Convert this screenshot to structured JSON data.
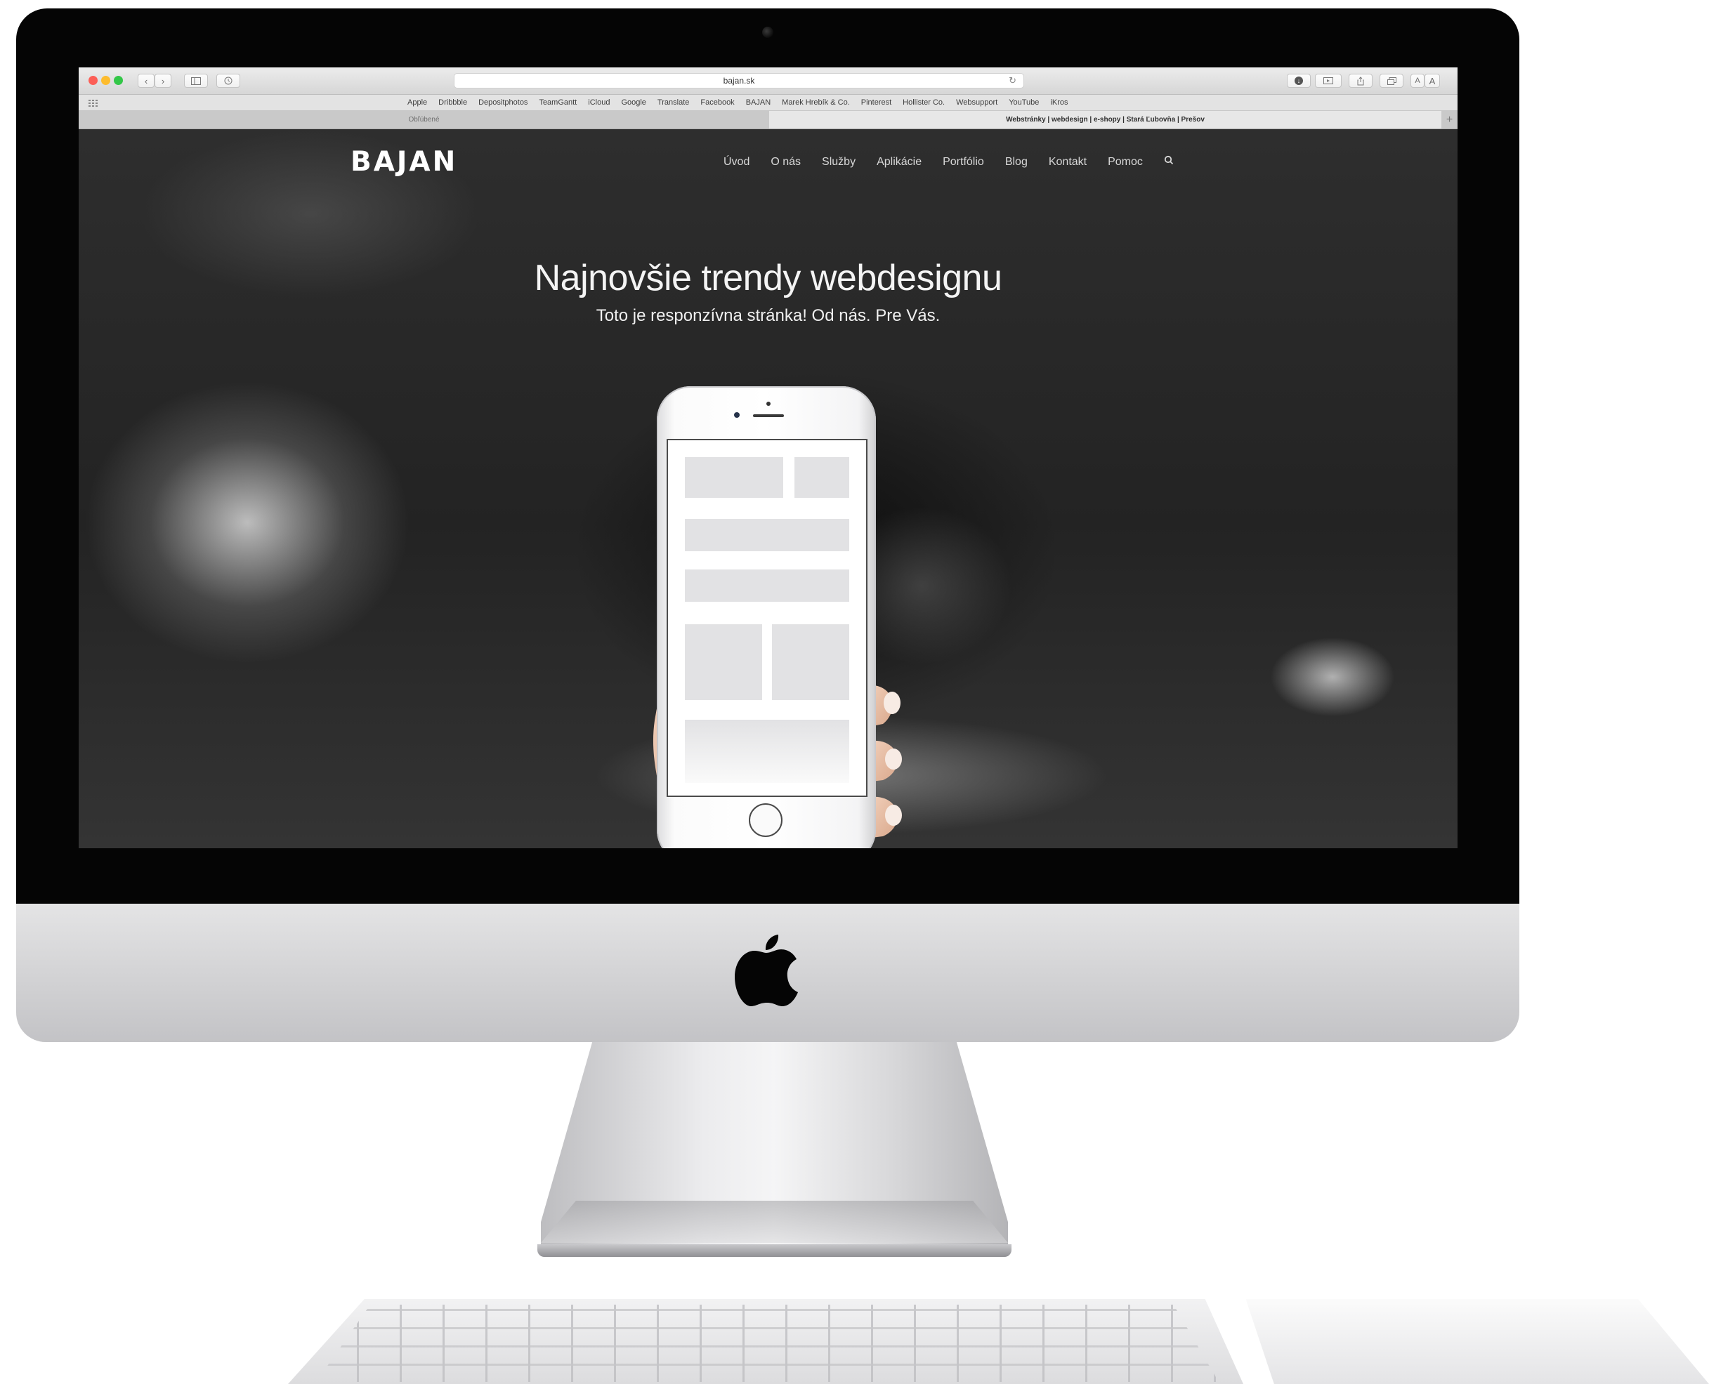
{
  "browser": {
    "url": "bajan.sk",
    "bookmarks": [
      "Apple",
      "Dribbble",
      "Depositphotos",
      "TeamGantt",
      "iCloud",
      "Google",
      "Translate",
      "Facebook",
      "BAJAN",
      "Marek Hrebík & Co.",
      "Pinterest",
      "Hollister Co.",
      "Websupport",
      "YouTube",
      "iKros"
    ],
    "tabs": [
      {
        "label": "Obľúbené",
        "active": false
      },
      {
        "label": "Webstránky | webdesign | e-shopy | Stará Ľubovňa | Prešov",
        "active": true
      }
    ],
    "new_tab_symbol": "+",
    "reader_text_small": "A",
    "reader_text_large": "A"
  },
  "site": {
    "logo": "BAJAN",
    "nav": [
      "Úvod",
      "O nás",
      "Služby",
      "Aplikácie",
      "Portfólio",
      "Blog",
      "Kontakt",
      "Pomoc"
    ],
    "hero_title": "Najnovšie trendy webdesignu",
    "hero_subtitle": "Toto je responzívna stránka! Od nás. Pre Vás."
  },
  "icons": {
    "nav_back": "chevron-left-icon",
    "nav_forward": "chevron-right-icon",
    "sidebar": "sidebar-icon",
    "history": "clock-icon",
    "reload": "reload-icon",
    "downloads": "download-icon",
    "share": "share-icon",
    "tabs": "tabs-icon",
    "search": "search-icon",
    "brand": "apple-logo"
  },
  "colors": {
    "close": "#fc5f57",
    "minimize": "#fdbc2e",
    "zoom": "#33c748",
    "bezel": "#050505"
  }
}
